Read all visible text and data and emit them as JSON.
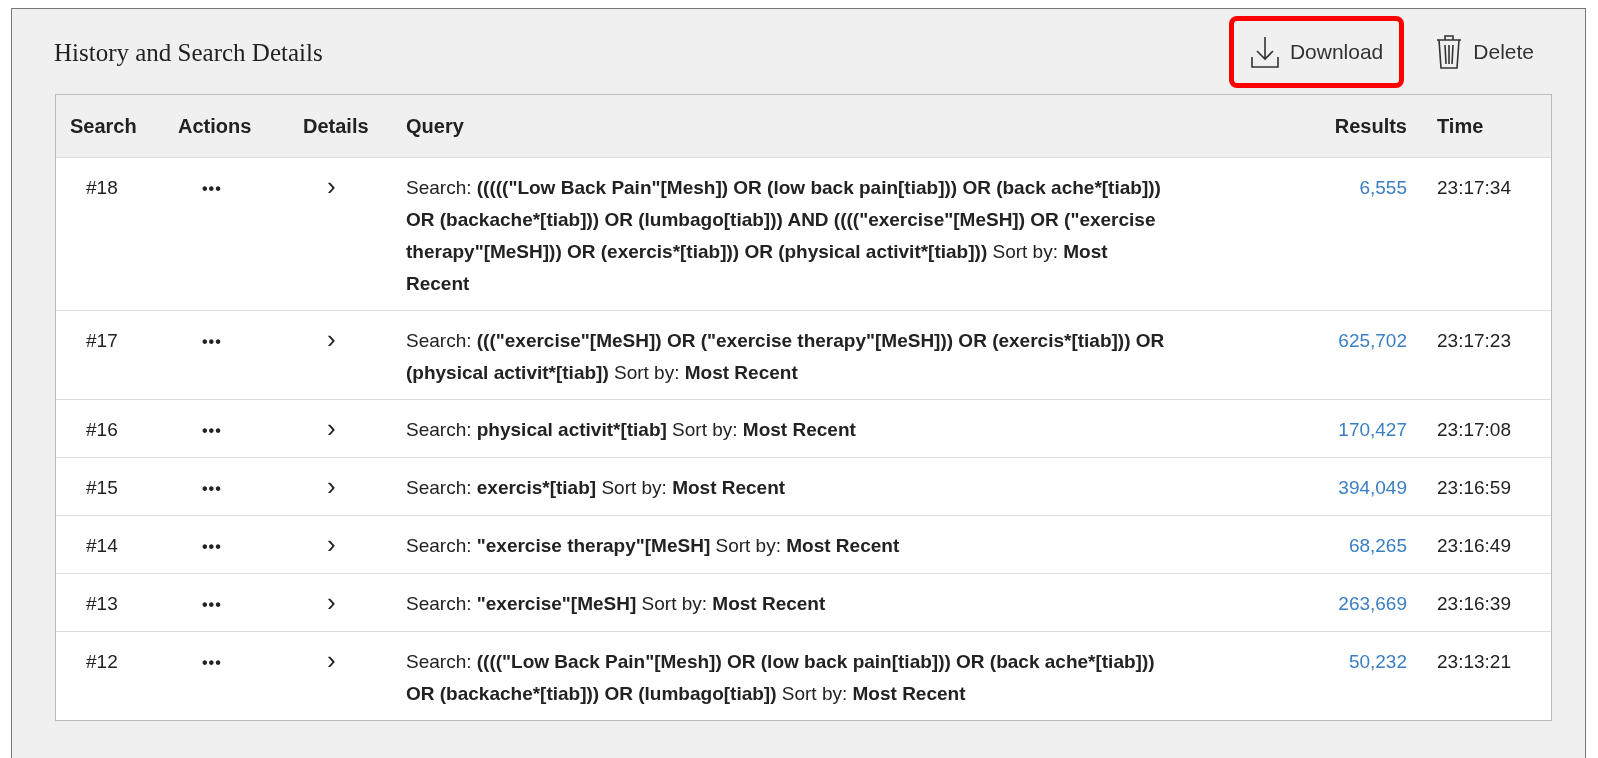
{
  "panel": {
    "title": "History and Search Details"
  },
  "toolbar": [
    {
      "kind": "download",
      "label": "Download",
      "highlighted": true
    },
    {
      "kind": "delete",
      "label": "Delete",
      "highlighted": false
    }
  ],
  "table": {
    "columns": [
      "Search",
      "Actions",
      "Details",
      "Query",
      "Results",
      "Time"
    ],
    "rows": [
      {
        "search": "#18",
        "actions": "•••",
        "details": "›",
        "query": "Search: **(((((\"Low Back Pain\"[Mesh]) OR (low back pain[tiab])) OR (back ache*[tiab])) OR (backache*[tiab])) OR (lumbago[tiab])) AND ((((\"exercise\"[MeSH]) OR (\"exercise therapy\"[MeSH])) OR (exercis*[tiab])) OR (physical activit*[tiab]))** Sort by: **Most Recent**",
        "results": "6,555",
        "time": "23:17:34"
      },
      {
        "search": "#17",
        "actions": "•••",
        "details": "›",
        "query": "Search: **(((\"exercise\"[MeSH]) OR (\"exercise therapy\"[MeSH])) OR (exercis*[tiab])) OR (physical activit*[tiab])** Sort by: **Most Recent**",
        "results": "625,702",
        "time": "23:17:23"
      },
      {
        "search": "#16",
        "actions": "•••",
        "details": "›",
        "query": "Search: **physical activit*[tiab]** Sort by: **Most Recent**",
        "results": "170,427",
        "time": "23:17:08"
      },
      {
        "search": "#15",
        "actions": "•••",
        "details": "›",
        "query": "Search: **exercis*[tiab]** Sort by: **Most Recent**",
        "results": "394,049",
        "time": "23:16:59"
      },
      {
        "search": "#14",
        "actions": "•••",
        "details": "›",
        "query": "Search: **\"exercise therapy\"[MeSH]** Sort by: **Most Recent**",
        "results": "68,265",
        "time": "23:16:49"
      },
      {
        "search": "#13",
        "actions": "•••",
        "details": "›",
        "query": "Search: **\"exercise\"[MeSH]** Sort by: **Most Recent**",
        "results": "263,669",
        "time": "23:16:39"
      },
      {
        "search": "#12",
        "actions": "•••",
        "details": "›",
        "query": "Search: **((((\"Low Back Pain\"[Mesh]) OR (low back pain[tiab])) OR (back ache*[tiab])) OR (backache*[tiab])) OR (lumbago[tiab])** Sort by: **Most Recent**",
        "results": "50,232",
        "time": "23:13:21"
      }
    ]
  }
}
